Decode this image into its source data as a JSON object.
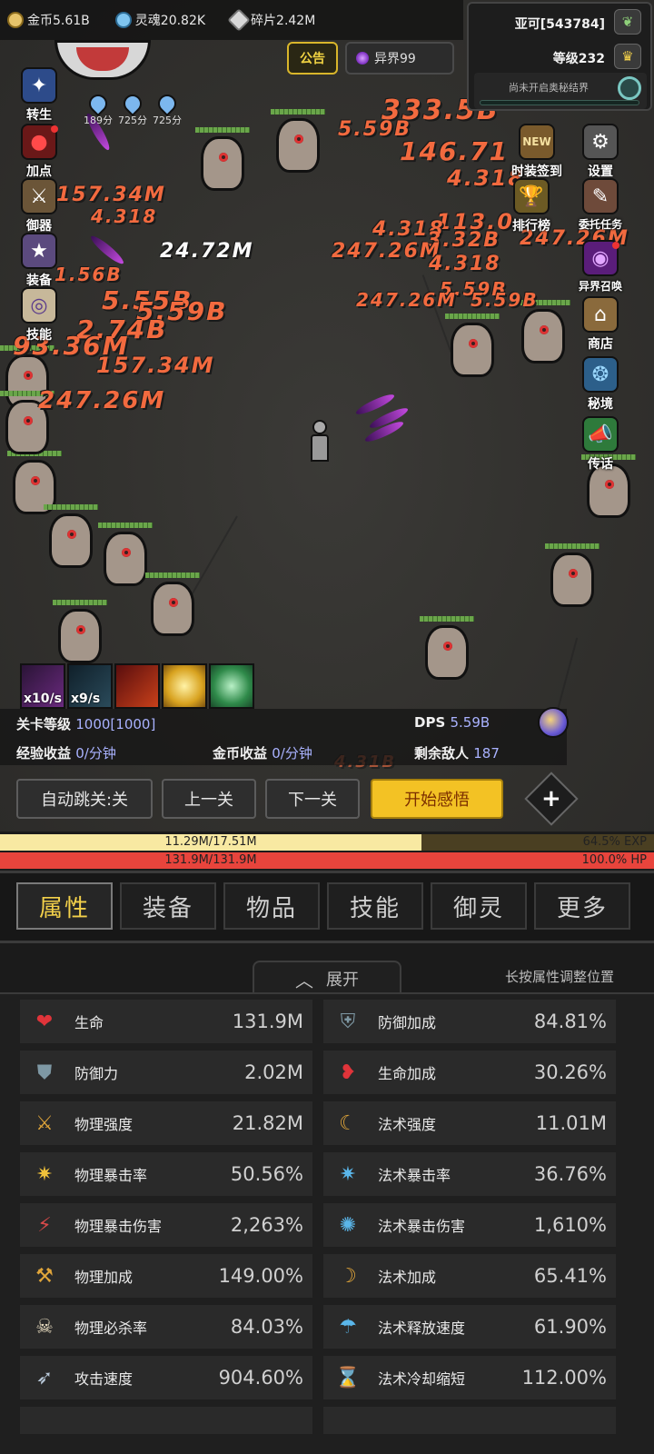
{
  "currencies": [
    {
      "label": "金币5.61B",
      "icon": "gold-coin-icon",
      "color": "#e7c46a"
    },
    {
      "label": "灵魂20.82K",
      "icon": "soul-icon",
      "color": "#7fc5f0"
    },
    {
      "label": "碎片2.42M",
      "icon": "shard-icon",
      "color": "#d8d8d8"
    }
  ],
  "profile": {
    "name": "亚可[543784]",
    "level": "等级232",
    "secret_realm": "尚未开启奥秘结界"
  },
  "notice_label": "公告",
  "otherworld_label": "异界99",
  "left_menu": [
    {
      "label": "转生",
      "icon": "rebirth-icon"
    },
    {
      "label": "加点",
      "icon": "blood-drop-icon"
    },
    {
      "label": "御器",
      "icon": "weapon-rack-icon"
    },
    {
      "label": "装备",
      "icon": "equipment-icon"
    },
    {
      "label": "技能",
      "icon": "skill-scroll-icon"
    }
  ],
  "buffs": [
    {
      "label": "189分"
    },
    {
      "label": "725分"
    },
    {
      "label": "725分"
    }
  ],
  "right_menu": [
    {
      "label": "设置",
      "icon": "gear-icon"
    },
    {
      "label": "时装签到",
      "icon": "costume-signin-icon",
      "badge": "NEW"
    },
    {
      "label": "排行榜",
      "icon": "trophy-icon"
    },
    {
      "label": "委托任务",
      "icon": "commission-icon"
    },
    {
      "label": "异界召唤",
      "icon": "summon-portal-icon"
    },
    {
      "label": "商店",
      "icon": "shop-icon"
    },
    {
      "label": "秘境",
      "icon": "secret-realm-icon"
    },
    {
      "label": "传话",
      "icon": "megaphone-icon"
    }
  ],
  "damage_numbers": [
    "333.5B",
    "5.59B",
    "146.71",
    "4.318",
    "157.34M",
    "4.318",
    "24.72M",
    "113.0",
    "4.318",
    "3.32B",
    "247.26M",
    "247.26M",
    "4.318",
    "1.56B",
    "5.59B",
    "247.26M",
    "5.59B",
    "5.55B",
    "5.59B",
    "2.74B",
    "93.36M",
    "157.34M",
    "247.26M",
    "4.31B"
  ],
  "skills": [
    {
      "rate": "x10/s",
      "icon": "dark-claw-skill-icon"
    },
    {
      "rate": "x9/s",
      "icon": "shadow-skill-icon"
    },
    {
      "rate": "",
      "icon": "fire-demon-skill-icon"
    },
    {
      "rate": "",
      "icon": "golden-burst-skill-icon"
    },
    {
      "rate": "",
      "icon": "green-eye-skill-icon"
    }
  ],
  "stage": {
    "level_label": "关卡等级",
    "level_value": "1000[1000]",
    "dps_label": "DPS",
    "dps_value": "5.59B",
    "exp_label": "经验收益",
    "exp_value": "0/分钟",
    "gold_label": "金币收益",
    "gold_value": "0/分钟",
    "enemies_label": "剩余敌人",
    "enemies_value": "187"
  },
  "actions": {
    "auto_skip": "自动跳关:关",
    "prev": "上一关",
    "next": "下一关",
    "enlighten": "开始感悟"
  },
  "exp_bar": {
    "text": "11.29M/17.51M",
    "percent": "64.5%",
    "unit": "EXP",
    "fraction": 0.645
  },
  "hp_bar": {
    "text": "131.9M/131.9M",
    "percent": "100.0%",
    "unit": "HP",
    "fraction": 1.0
  },
  "tabs": [
    "属性",
    "装备",
    "物品",
    "技能",
    "御灵",
    "更多"
  ],
  "expand_label": "展开",
  "hint": "长按属性调整位置",
  "stats": [
    {
      "name": "生命",
      "value": "131.9M",
      "icon": "heart-icon"
    },
    {
      "name": "防御加成",
      "value": "84.81%",
      "icon": "shield-plus-icon"
    },
    {
      "name": "防御力",
      "value": "2.02M",
      "icon": "shield-icon"
    },
    {
      "name": "生命加成",
      "value": "30.26%",
      "icon": "heart-plus-icon"
    },
    {
      "name": "物理强度",
      "value": "21.82M",
      "icon": "sword-icon"
    },
    {
      "name": "法术强度",
      "value": "11.01M",
      "icon": "magic-crescent-icon"
    },
    {
      "name": "物理暴击率",
      "value": "50.56%",
      "icon": "crit-sword-icon"
    },
    {
      "name": "法术暴击率",
      "value": "36.76%",
      "icon": "magic-crit-icon"
    },
    {
      "name": "物理暴击伤害",
      "value": "2,263%",
      "icon": "crit-damage-icon"
    },
    {
      "name": "法术暴击伤害",
      "value": "1,610%",
      "icon": "magic-crit-damage-icon"
    },
    {
      "name": "物理加成",
      "value": "149.00%",
      "icon": "physical-bonus-icon"
    },
    {
      "name": "法术加成",
      "value": "65.41%",
      "icon": "magic-bonus-icon"
    },
    {
      "name": "物理必杀率",
      "value": "84.03%",
      "icon": "skull-icon"
    },
    {
      "name": "法术释放速度",
      "value": "61.90%",
      "icon": "cast-speed-icon"
    },
    {
      "name": "攻击速度",
      "value": "904.60%",
      "icon": "attack-speed-icon"
    },
    {
      "name": "法术冷却缩短",
      "value": "112.00%",
      "icon": "hourglass-icon"
    }
  ]
}
